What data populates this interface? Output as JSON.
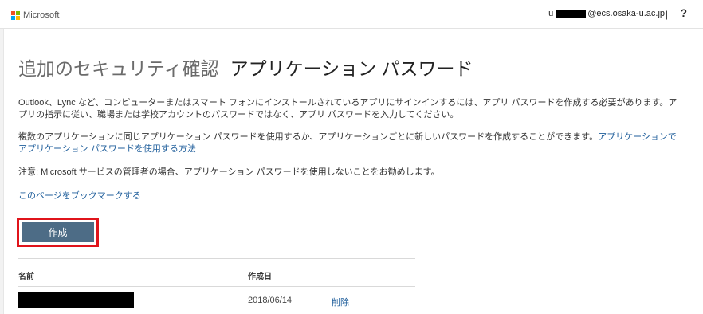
{
  "header": {
    "brand": "Microsoft",
    "logo_colors": [
      "#f25022",
      "#7fba00",
      "#00a4ef",
      "#ffb900"
    ],
    "user_prefix": "u",
    "user_suffix": "@ecs.osaka-u.ac.jp",
    "separator": "|",
    "help": "?"
  },
  "page": {
    "title_main": "追加のセキュリティ確認",
    "title_sub": "アプリケーション パスワード",
    "para1": "Outlook、Lync など、コンピューターまたはスマート フォンにインストールされているアプリにサインインするには、アプリ パスワードを作成する必要があります。アプリの指示に従い、職場または学校アカウントのパスワードではなく、アプリ パスワードを入力してください。",
    "para2_text": "複数のアプリケーションに同じアプリケーション パスワードを使用するか、アプリケーションごとに新しいパスワードを作成することができます。",
    "para2_link": "アプリケーションでアプリケーション パスワードを使用する方法",
    "para3": "注意: Microsoft サービスの管理者の場合、アプリケーション パスワードを使用しないことをお勧めします。",
    "bookmark_link": "このページをブックマークする",
    "create_button": "作成"
  },
  "table": {
    "headers": {
      "name": "名前",
      "created": "作成日"
    },
    "rows": [
      {
        "date": "2018/06/14",
        "action": "削除"
      }
    ]
  },
  "colors": {
    "link": "#1f5e9b",
    "button_bg": "#4d6c86",
    "highlight": "#e0141b"
  }
}
